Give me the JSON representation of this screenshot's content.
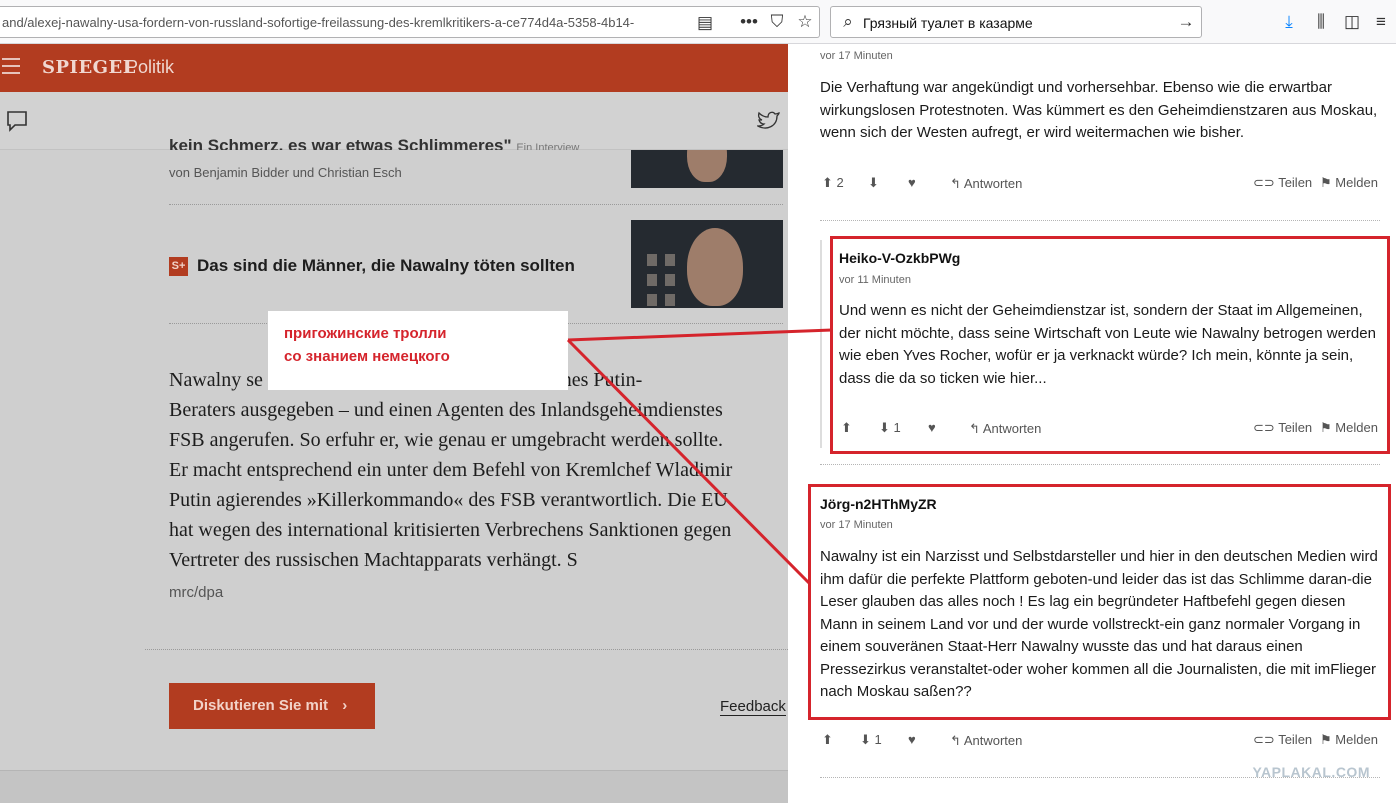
{
  "browser": {
    "url": "and/alexej-nawalny-usa-fordern-von-russland-sofortige-freilassung-des-kremlkritikers-a-ce774d4a-5358-4b14-",
    "search_value": "Грязный туалет в казарме"
  },
  "spiegel": {
    "brand": "SPIEGEL",
    "section": "Politik",
    "teaser1_title_partial": "kein Schmerz, es war etwas Schlimmeres\"",
    "teaser1_title_extra": "Ein Interview",
    "teaser1_byline": "von Benjamin Bidder und Christian Esch",
    "teaser2_badge": "S+",
    "teaser2_title": "Das sind die Männer, die Nawalny töten sollten",
    "article_lines": [
      "Nawalny se                                    als Assistent eines Putin-",
      "Beraters ausgegeben – und einen Agenten des Inlandsgeheimdienstes",
      "FSB angerufen. So erfuhr er, wie genau er umgebracht werden sollte.",
      "Er macht entsprechend ein unter dem Befehl von Kremlchef Wladimir",
      "Putin agierendes »Killerkommando« des FSB verantwortlich. Die EU",
      "hat wegen des international kritisierten Verbrechens Sanktionen gegen",
      "Vertreter des russischen Machtapparats verhängt. S"
    ],
    "source": "mrc/dpa",
    "cta_label": "Diskutieren Sie mit",
    "cta_chevron": "›",
    "feedback_label": "Feedback"
  },
  "annotation": {
    "line1": "пригожинские тролли",
    "line2": "со знанием немецкого",
    "color": "#d5242c"
  },
  "comments": [
    {
      "user": "",
      "time": "vor 17 Minuten",
      "body": "Die Verhaftung war angekündigt und vorhersehbar. Ebenso wie die erwartbar wirkungslosen Protestnoten. Was kümmert es den Geheimdienstzaren aus Moskau, wenn sich der Westen aufregt, er wird weitermachen wie bisher.",
      "up": "2",
      "down": "",
      "reply": "Antworten",
      "share": "Teilen",
      "report": "Melden"
    },
    {
      "user": "Heiko-V-OzkbPWg",
      "time": "vor 11 Minuten",
      "body": "Und wenn es nicht der Geheimdienstzar ist, sondern der Staat im Allgemeinen, der nicht möchte, dass seine Wirtschaft von Leute wie Nawalny betrogen werden wie eben Yves Rocher, wofür er ja verknackt würde? Ich mein, könnte ja sein, dass die da so ticken wie hier...",
      "up": "",
      "down": "1",
      "reply": "Antworten",
      "share": "Teilen",
      "report": "Melden"
    },
    {
      "user": "Jörg-n2HThMyZR",
      "time": "vor 17 Minuten",
      "body": "Nawalny ist ein Narzisst und Selbstdarsteller und hier in den deutschen Medien wird ihm dafür die perfekte Plattform geboten-und leider das ist das Schlimme daran-die Leser glauben das alles noch ! Es lag ein begründeter Haftbefehl gegen diesen Mann in seinem Land vor und der wurde vollstreckt-ein ganz normaler Vorgang in einem souveränen Staat-Herr Nawalny wusste das und hat daraus einen Pressezirkus veranstaltet-oder woher kommen all die Journalisten, die mit imFlieger nach Moskau saßen??",
      "up": "",
      "down": "1",
      "reply": "Antworten",
      "share": "Teilen",
      "report": "Melden"
    }
  ],
  "watermark": "YAPLAKAL.COM"
}
